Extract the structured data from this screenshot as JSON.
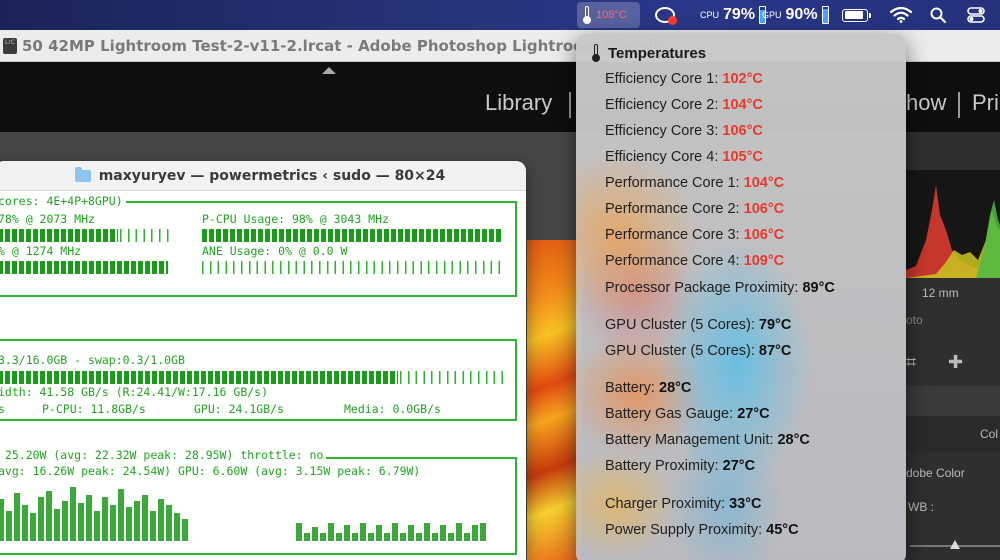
{
  "menubar": {
    "temp_value": "108°C",
    "stat1": {
      "top": "CPU",
      "bottom": "",
      "value": "79%",
      "fill": 0.79
    },
    "stat2": {
      "top": "GPU",
      "bottom": "",
      "value": "90%",
      "fill": 0.9
    },
    "battery_fill": 0.9,
    "colors": {
      "accent_blue": "#4ea1ff",
      "hot_red": "#e8392f"
    }
  },
  "lightroom": {
    "app_icon_text": "LrC",
    "window_title": "50 42MP Lightroom Test-2-v11-2.lrcat - Adobe Photoshop Lightroom Classic",
    "modules": [
      "Library",
      "how",
      "Pri"
    ],
    "histogram_lens": "12 mm",
    "photo_label": "oto",
    "panel_color": "Col",
    "profile": "dobe Color",
    "wb": "WB :"
  },
  "terminal": {
    "title": "maxyuryev — powermetrics ‹ sudo — 80×24",
    "lines": {
      "l1": "cores: 4E+4P+8GPU)",
      "l2a": "78% @ 2073 MHz",
      "l2b": "P-CPU Usage: 98% @ 3043 MHz",
      "l3a": "% @ 1274 MHz",
      "l3b": "ANE Usage: 0% @ 0.0 W",
      "l4": "3.3/16.0GB - swap:0.3/1.0GB",
      "l5": "idth: 41.58 GB/s (R:24.41/W:17.16 GB/s)",
      "l6a": "s",
      "l6b": "P-CPU: 11.8GB/s",
      "l6c": "GPU: 24.1GB/s",
      "l6d": "Media: 0.0GB/s",
      "l7": " 25.20W (avg: 22.32W peak: 28.95W) throttle: no",
      "l8": "avg: 16.26W peak: 24.54W) GPU: 6.60W (avg: 3.15W peak: 6.79W)"
    }
  },
  "temperatures": {
    "title": "Temperatures",
    "items": [
      {
        "label": "Efficiency Core 1:",
        "value": "102°C",
        "hot": true
      },
      {
        "label": "Efficiency Core 2:",
        "value": "104°C",
        "hot": true
      },
      {
        "label": "Efficiency Core 3:",
        "value": "106°C",
        "hot": true
      },
      {
        "label": "Efficiency Core 4:",
        "value": "105°C",
        "hot": true
      },
      {
        "label": "Performance Core 1:",
        "value": "104°C",
        "hot": true
      },
      {
        "label": "Performance Core 2:",
        "value": "106°C",
        "hot": true
      },
      {
        "label": "Performance Core 3:",
        "value": "106°C",
        "hot": true
      },
      {
        "label": "Performance Core 4:",
        "value": "109°C",
        "hot": true
      },
      {
        "label": "Processor Package Proximity:",
        "value": "89°C",
        "hot": false
      },
      {
        "label": "GPU Cluster (5 Cores):",
        "value": "79°C",
        "hot": false
      },
      {
        "label": "GPU Cluster (5 Cores):",
        "value": "87°C",
        "hot": false
      },
      {
        "label": "Battery:",
        "value": "28°C",
        "hot": false
      },
      {
        "label": "Battery Gas Gauge:",
        "value": "27°C",
        "hot": false
      },
      {
        "label": "Battery Management Unit:",
        "value": "28°C",
        "hot": false
      },
      {
        "label": "Battery Proximity:",
        "value": "27°C",
        "hot": false
      },
      {
        "label": "Charger Proximity:",
        "value": "33°C",
        "hot": false
      },
      {
        "label": "Power Supply Proximity:",
        "value": "45°C",
        "hot": false
      }
    ]
  }
}
